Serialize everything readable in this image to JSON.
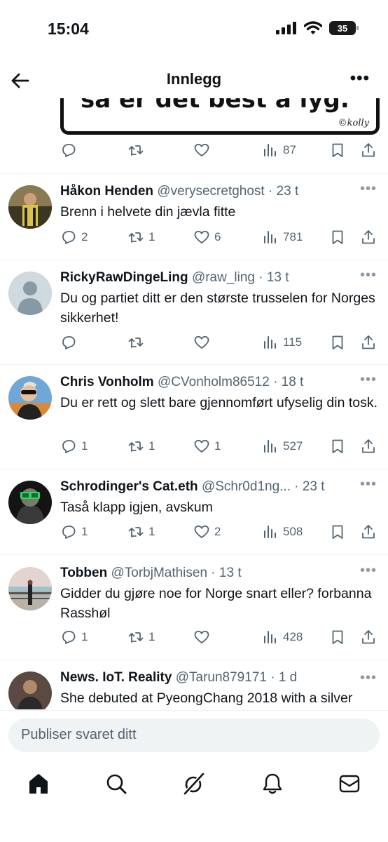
{
  "status": {
    "time": "15:04",
    "battery": "35"
  },
  "header": {
    "title": "Innlegg",
    "more": "•••"
  },
  "image_card": {
    "text": "så er det best å lyg.",
    "signature": "©kolly"
  },
  "top_actions": {
    "views": "87"
  },
  "tweets": [
    {
      "name": "Håkon Henden",
      "handle": "@verysecretghost · 23 t",
      "text": "Brenn i helvete din jævla fitte",
      "replies": "2",
      "retweets": "1",
      "likes": "6",
      "views": "781"
    },
    {
      "name": "RickyRawDingeLing",
      "handle": "@raw_ling · 13 t",
      "text": "Du og partiet ditt er den største trusselen for Norges sikkerhet!",
      "replies": "",
      "retweets": "",
      "likes": "",
      "views": "115"
    },
    {
      "name": "Chris Vonholm",
      "handle": "@CVonholm86512 · 18 t",
      "text": "Du er rett og slett bare gjennomført ufyselig din tosk.",
      "replies": "1",
      "retweets": "1",
      "likes": "1",
      "views": "527"
    },
    {
      "name": "Schrodinger's Cat.eth",
      "handle": "@Schr0d1ng... · 23 t",
      "text": "Taså klapp igjen, avskum",
      "replies": "1",
      "retweets": "1",
      "likes": "2",
      "views": "508"
    },
    {
      "name": "Tobben",
      "handle": "@TorbjMathisen · 13 t",
      "text": "Gidder du gjøre noe for Norge snart eller? forbanna Rasshøl",
      "replies": "1",
      "retweets": "1",
      "likes": "",
      "views": "428"
    },
    {
      "name": "News. IoT. Reality",
      "handle": "@Tarun879171 · 1 d",
      "text": "She debuted at PyeongChang 2018 with a silver",
      "replies": "",
      "retweets": "",
      "likes": "",
      "views": ""
    }
  ],
  "reply_box": {
    "placeholder": "Publiser svaret ditt"
  },
  "tabbar": [
    "home-icon",
    "search-icon",
    "grok-icon",
    "notifications-icon",
    "messages-icon"
  ]
}
